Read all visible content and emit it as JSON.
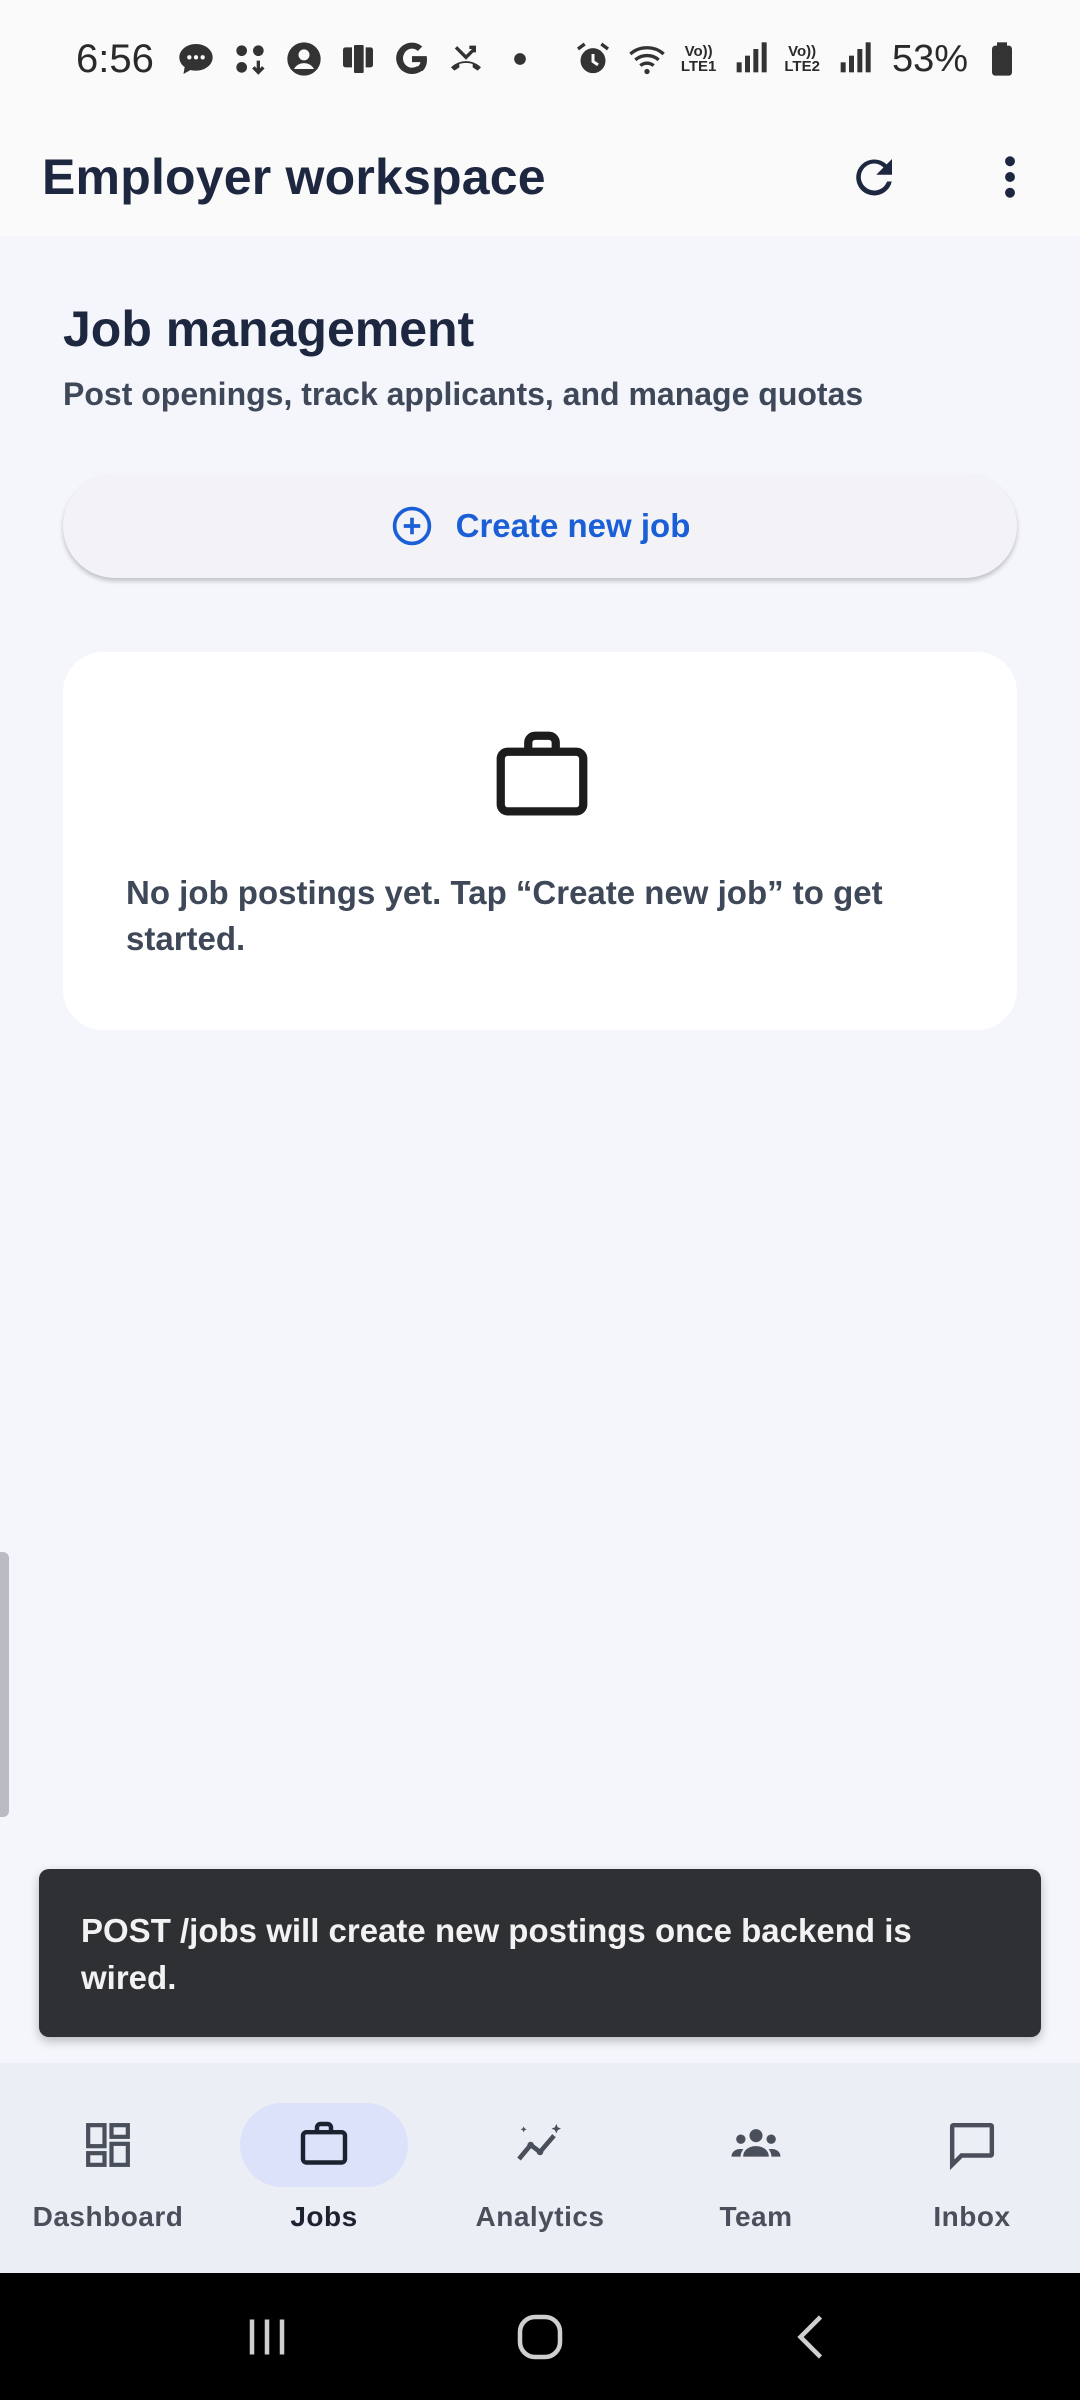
{
  "status_bar": {
    "time": "6:56",
    "battery": "53%",
    "sim1": {
      "top": "Vo))",
      "bottom": "LTE1"
    },
    "sim2": {
      "top": "Vo))",
      "bottom": "LTE2"
    },
    "notification_icons": [
      "chat-icon",
      "apps-icon",
      "account-icon",
      "device-icon",
      "google-icon",
      "missed-call-icon",
      "dot-icon"
    ],
    "system_icons": [
      "alarm-icon",
      "wifi-icon",
      "signal-icon",
      "signal-icon",
      "battery-icon"
    ]
  },
  "app_bar": {
    "title": "Employer workspace",
    "actions": [
      "refresh-icon",
      "more-vert-icon"
    ]
  },
  "main": {
    "title": "Job management",
    "subtitle": "Post openings, track applicants, and manage quotas",
    "create_button": {
      "label": "Create new job",
      "icon": "add-circle-icon"
    },
    "empty_state": {
      "icon": "briefcase-icon",
      "text": "No job postings yet. Tap “Create new job” to get started."
    }
  },
  "snackbar": {
    "message": "POST /jobs will create new postings once backend is wired."
  },
  "bottom_nav": {
    "items": [
      {
        "label": "Dashboard",
        "icon": "dashboard-icon",
        "active": false
      },
      {
        "label": "Jobs",
        "icon": "briefcase-icon",
        "active": true
      },
      {
        "label": "Analytics",
        "icon": "analytics-icon",
        "active": false
      },
      {
        "label": "Team",
        "icon": "team-icon",
        "active": false
      },
      {
        "label": "Inbox",
        "icon": "chat-bubble-icon",
        "active": false
      }
    ]
  },
  "colors": {
    "accent": "#1a5fd6",
    "background": "#f4f6fb",
    "active_pill": "#dde2fb",
    "snackbar": "#2f3034"
  }
}
